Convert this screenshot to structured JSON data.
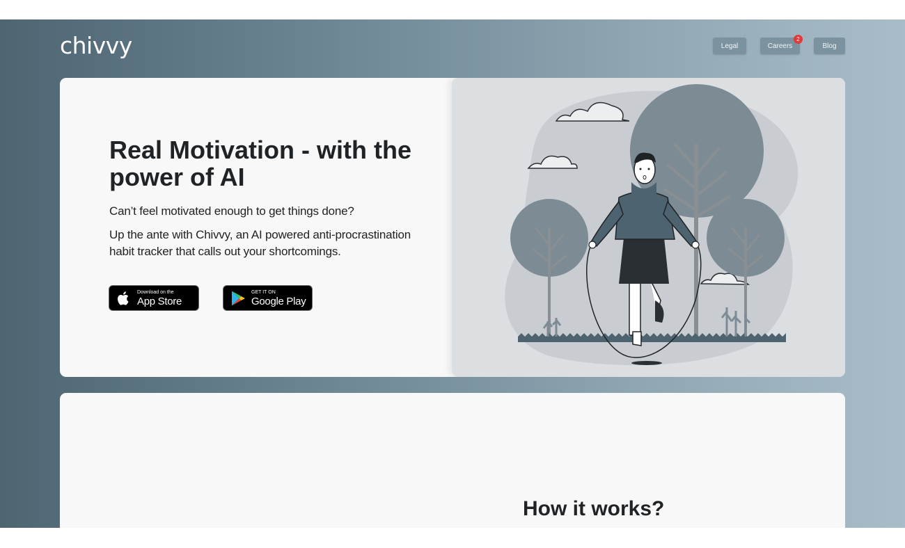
{
  "brand": {
    "logo_text": "chivvy"
  },
  "nav": {
    "legal_label": "Legal",
    "careers_label": "Careers",
    "careers_badge": "2",
    "blog_label": "Blog"
  },
  "hero": {
    "title": "Real Motivation - with the power of AI",
    "subtitle": "Can’t feel motivated enough to get things done?",
    "description": "Up the ante with Chivvy, an AI powered anti-procrastination habit tracker that calls out your shortcomings.",
    "app_store": {
      "small": "Download on the",
      "big": "App Store",
      "icon": "apple-icon"
    },
    "google_play": {
      "small": "GET IT ON",
      "big": "Google Play",
      "icon": "google-play-icon"
    },
    "illustration": "person-jumping-rope-among-trees"
  },
  "how_it_works": {
    "title": "How it works?"
  },
  "colors": {
    "background_start": "#4e6572",
    "background_end": "#a8bdc8",
    "card": "#f8f8f8",
    "nav_button": "#7b939f",
    "badge": "#e03a3a",
    "illustration_bg": "#dcdfe2"
  }
}
